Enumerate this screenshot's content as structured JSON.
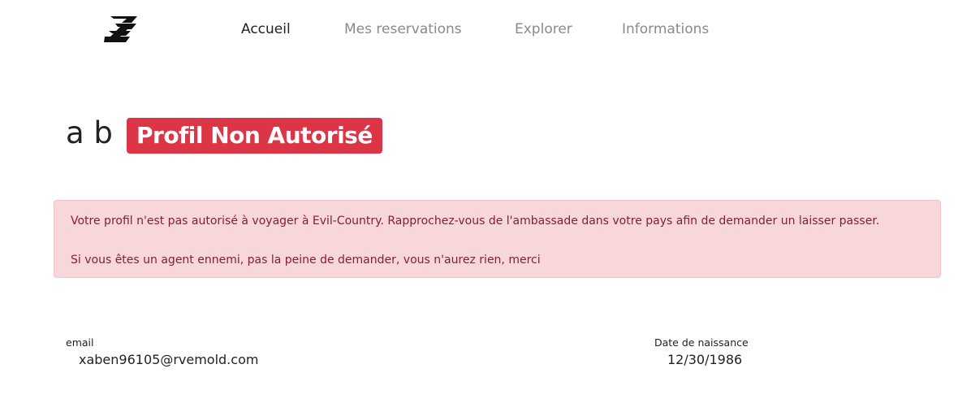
{
  "nav": {
    "logo_icon": "brand-logo-icon",
    "items": [
      {
        "label": "Accueil",
        "active": true
      },
      {
        "label": "Mes reservations",
        "active": false
      },
      {
        "label": "Explorer",
        "active": false
      },
      {
        "label": "Informations",
        "active": false
      }
    ]
  },
  "profile": {
    "name": "a b",
    "status_badge": "Profil Non Autorisé",
    "status_color": "#dc3545"
  },
  "alert": {
    "line1": "Votre profil n'est pas autorisé à voyager à Evil-Country. Rapprochez-vous de l'ambassade dans votre pays afin de demander un laisser passer.",
    "line2": "Si vous êtes un agent ennemi, pas la peine de demander, vous n'aurez rien, merci",
    "background": "#f8d7da",
    "text_color": "#842029"
  },
  "fields": {
    "email_label": "email",
    "email_value": "xaben96105@rvemold.com",
    "dob_label": "Date de naissance",
    "dob_value": "12/30/1986"
  }
}
